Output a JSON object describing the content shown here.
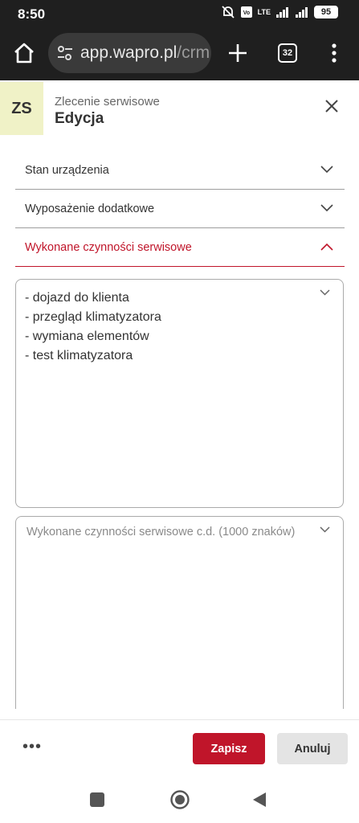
{
  "status_bar": {
    "time": "8:50",
    "network": "LTE",
    "battery": "95",
    "icons": [
      "muted-alarm-icon",
      "volte-icon",
      "signal-icon",
      "signal-icon",
      "battery-icon"
    ]
  },
  "browser": {
    "url_host": "app.wapro.pl",
    "url_path": "/crm",
    "tab_count": "32",
    "icons": [
      "home-icon",
      "tune-icon",
      "plus-icon",
      "tabs-icon",
      "more-vert-icon"
    ]
  },
  "header": {
    "badge": "ZS",
    "subtitle": "Zlecenie serwisowe",
    "title": "Edycja"
  },
  "sections": [
    {
      "label": "Stan urządzenia",
      "expanded": false
    },
    {
      "label": "Wyposażenie dodatkowe",
      "expanded": false
    },
    {
      "label": "Wykonane czynności serwisowe",
      "expanded": true
    }
  ],
  "fields": {
    "services_done": {
      "value": "- dojazd do klienta\n- przegląd klimatyzatora\n- wymiana elementów\n- test klimatyzatora"
    },
    "services_done_cont": {
      "placeholder": "Wykonane czynności serwisowe c.d. (1000 znaków)",
      "value": ""
    }
  },
  "footer": {
    "more": "•••",
    "save": "Zapisz",
    "cancel": "Anuluj"
  },
  "colors": {
    "accent": "#c0152a",
    "badge_bg": "#f0f2c7",
    "toolbar_bg": "#1f1f1f"
  }
}
